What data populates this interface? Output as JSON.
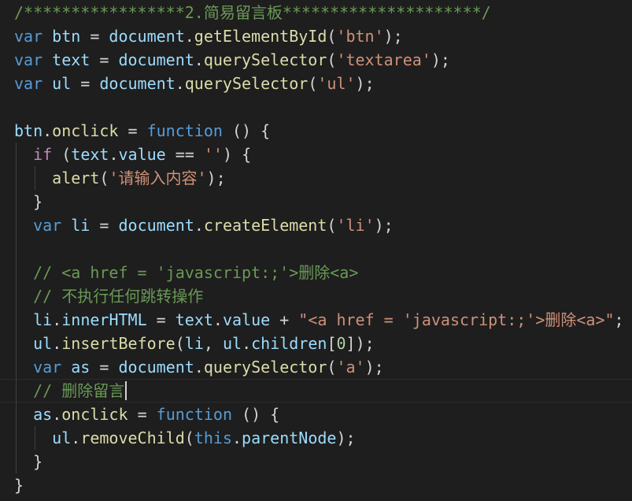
{
  "colors": {
    "background": "#1e1e1e",
    "comment": "#6a9955",
    "keyword": "#569cd6",
    "control": "#c586c0",
    "variable": "#9cdcfe",
    "function": "#dcdcaa",
    "string": "#ce9178",
    "number": "#b5cea8",
    "plain": "#d4d4d4"
  },
  "cursor": {
    "line": 17
  },
  "lines": [
    [
      {
        "t": "/*****************2.简易留言板*********************/",
        "c": "comment"
      }
    ],
    [
      {
        "t": "var",
        "c": "keyword"
      },
      {
        "t": " ",
        "c": "plain"
      },
      {
        "t": "btn",
        "c": "variable"
      },
      {
        "t": " = ",
        "c": "plain"
      },
      {
        "t": "document",
        "c": "variable"
      },
      {
        "t": ".",
        "c": "plain"
      },
      {
        "t": "getElementById",
        "c": "function"
      },
      {
        "t": "(",
        "c": "plain"
      },
      {
        "t": "'btn'",
        "c": "string"
      },
      {
        "t": ");",
        "c": "plain"
      }
    ],
    [
      {
        "t": "var",
        "c": "keyword"
      },
      {
        "t": " ",
        "c": "plain"
      },
      {
        "t": "text",
        "c": "variable"
      },
      {
        "t": " = ",
        "c": "plain"
      },
      {
        "t": "document",
        "c": "variable"
      },
      {
        "t": ".",
        "c": "plain"
      },
      {
        "t": "querySelector",
        "c": "function"
      },
      {
        "t": "(",
        "c": "plain"
      },
      {
        "t": "'textarea'",
        "c": "string"
      },
      {
        "t": ");",
        "c": "plain"
      }
    ],
    [
      {
        "t": "var",
        "c": "keyword"
      },
      {
        "t": " ",
        "c": "plain"
      },
      {
        "t": "ul",
        "c": "variable"
      },
      {
        "t": " = ",
        "c": "plain"
      },
      {
        "t": "document",
        "c": "variable"
      },
      {
        "t": ".",
        "c": "plain"
      },
      {
        "t": "querySelector",
        "c": "function"
      },
      {
        "t": "(",
        "c": "plain"
      },
      {
        "t": "'ul'",
        "c": "string"
      },
      {
        "t": ");",
        "c": "plain"
      }
    ],
    [],
    [
      {
        "t": "btn",
        "c": "variable"
      },
      {
        "t": ".",
        "c": "plain"
      },
      {
        "t": "onclick",
        "c": "function"
      },
      {
        "t": " = ",
        "c": "plain"
      },
      {
        "t": "function",
        "c": "keyword"
      },
      {
        "t": " () {",
        "c": "plain"
      }
    ],
    [
      {
        "t": "  ",
        "c": "plain"
      },
      {
        "t": "if",
        "c": "control"
      },
      {
        "t": " (",
        "c": "plain"
      },
      {
        "t": "text",
        "c": "variable"
      },
      {
        "t": ".",
        "c": "plain"
      },
      {
        "t": "value",
        "c": "variable"
      },
      {
        "t": " == ",
        "c": "plain"
      },
      {
        "t": "''",
        "c": "string"
      },
      {
        "t": ") {",
        "c": "plain"
      }
    ],
    [
      {
        "t": "    ",
        "c": "plain"
      },
      {
        "t": "alert",
        "c": "function"
      },
      {
        "t": "(",
        "c": "plain"
      },
      {
        "t": "'请输入内容'",
        "c": "string"
      },
      {
        "t": ");",
        "c": "plain"
      }
    ],
    [
      {
        "t": "  }",
        "c": "plain"
      }
    ],
    [
      {
        "t": "  ",
        "c": "plain"
      },
      {
        "t": "var",
        "c": "keyword"
      },
      {
        "t": " ",
        "c": "plain"
      },
      {
        "t": "li",
        "c": "variable"
      },
      {
        "t": " = ",
        "c": "plain"
      },
      {
        "t": "document",
        "c": "variable"
      },
      {
        "t": ".",
        "c": "plain"
      },
      {
        "t": "createElement",
        "c": "function"
      },
      {
        "t": "(",
        "c": "plain"
      },
      {
        "t": "'li'",
        "c": "string"
      },
      {
        "t": ");",
        "c": "plain"
      }
    ],
    [],
    [
      {
        "t": "  ",
        "c": "plain"
      },
      {
        "t": "// <a href = 'javascript:;'>删除<a>",
        "c": "comment"
      }
    ],
    [
      {
        "t": "  ",
        "c": "plain"
      },
      {
        "t": "// 不执行任何跳转操作",
        "c": "comment"
      }
    ],
    [
      {
        "t": "  ",
        "c": "plain"
      },
      {
        "t": "li",
        "c": "variable"
      },
      {
        "t": ".",
        "c": "plain"
      },
      {
        "t": "innerHTML",
        "c": "variable"
      },
      {
        "t": " = ",
        "c": "plain"
      },
      {
        "t": "text",
        "c": "variable"
      },
      {
        "t": ".",
        "c": "plain"
      },
      {
        "t": "value",
        "c": "variable"
      },
      {
        "t": " + ",
        "c": "plain"
      },
      {
        "t": "\"<a href = 'javascript:;'>删除<a>\"",
        "c": "string"
      },
      {
        "t": ";",
        "c": "plain"
      }
    ],
    [
      {
        "t": "  ",
        "c": "plain"
      },
      {
        "t": "ul",
        "c": "variable"
      },
      {
        "t": ".",
        "c": "plain"
      },
      {
        "t": "insertBefore",
        "c": "function"
      },
      {
        "t": "(",
        "c": "plain"
      },
      {
        "t": "li",
        "c": "variable"
      },
      {
        "t": ", ",
        "c": "plain"
      },
      {
        "t": "ul",
        "c": "variable"
      },
      {
        "t": ".",
        "c": "plain"
      },
      {
        "t": "children",
        "c": "variable"
      },
      {
        "t": "[",
        "c": "plain"
      },
      {
        "t": "0",
        "c": "number"
      },
      {
        "t": "]);",
        "c": "plain"
      }
    ],
    [
      {
        "t": "  ",
        "c": "plain"
      },
      {
        "t": "var",
        "c": "keyword"
      },
      {
        "t": " ",
        "c": "plain"
      },
      {
        "t": "as",
        "c": "variable"
      },
      {
        "t": " = ",
        "c": "plain"
      },
      {
        "t": "document",
        "c": "variable"
      },
      {
        "t": ".",
        "c": "plain"
      },
      {
        "t": "querySelector",
        "c": "function"
      },
      {
        "t": "(",
        "c": "plain"
      },
      {
        "t": "'a'",
        "c": "string"
      },
      {
        "t": ");",
        "c": "plain"
      }
    ],
    [
      {
        "t": "  ",
        "c": "plain"
      },
      {
        "t": "// 删除留言",
        "c": "comment"
      }
    ],
    [
      {
        "t": "  ",
        "c": "plain"
      },
      {
        "t": "as",
        "c": "variable"
      },
      {
        "t": ".",
        "c": "plain"
      },
      {
        "t": "onclick",
        "c": "function"
      },
      {
        "t": " = ",
        "c": "plain"
      },
      {
        "t": "function",
        "c": "keyword"
      },
      {
        "t": " () {",
        "c": "plain"
      }
    ],
    [
      {
        "t": "    ",
        "c": "plain"
      },
      {
        "t": "ul",
        "c": "variable"
      },
      {
        "t": ".",
        "c": "plain"
      },
      {
        "t": "removeChild",
        "c": "function"
      },
      {
        "t": "(",
        "c": "plain"
      },
      {
        "t": "this",
        "c": "keyword"
      },
      {
        "t": ".",
        "c": "plain"
      },
      {
        "t": "parentNode",
        "c": "variable"
      },
      {
        "t": ");",
        "c": "plain"
      }
    ],
    [
      {
        "t": "  }",
        "c": "plain"
      }
    ],
    [
      {
        "t": "}",
        "c": "plain"
      }
    ]
  ]
}
